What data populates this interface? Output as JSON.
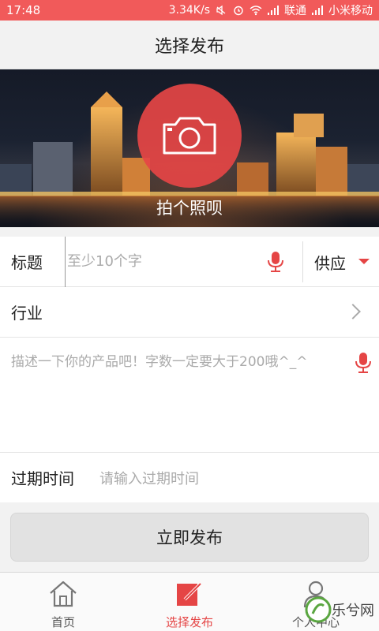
{
  "status_bar": {
    "time": "17:48",
    "speed": "3.34K/s",
    "carrier1": "联通",
    "carrier2": "小米移动"
  },
  "header": {
    "title": "选择发布"
  },
  "hero": {
    "label": "拍个照呗"
  },
  "form": {
    "title_label": "标题",
    "title_placeholder": "至少10个字",
    "type_value": "供应",
    "industry_label": "行业",
    "description_placeholder": "描述一下你的产品吧！字数一定要大于200哦^_^",
    "expire_label": "过期时间",
    "expire_placeholder": "请输入过期时间"
  },
  "publish_button": "立即发布",
  "bottom_nav": {
    "items": [
      {
        "label": "首页",
        "icon": "home-icon",
        "active": false
      },
      {
        "label": "选择发布",
        "icon": "publish-icon",
        "active": true
      },
      {
        "label": "个人中心",
        "icon": "user-icon",
        "active": false
      }
    ]
  },
  "watermark": {
    "text": "乐兮网"
  },
  "colors": {
    "accent": "#e54545",
    "status_bar": "#f15a5a"
  }
}
